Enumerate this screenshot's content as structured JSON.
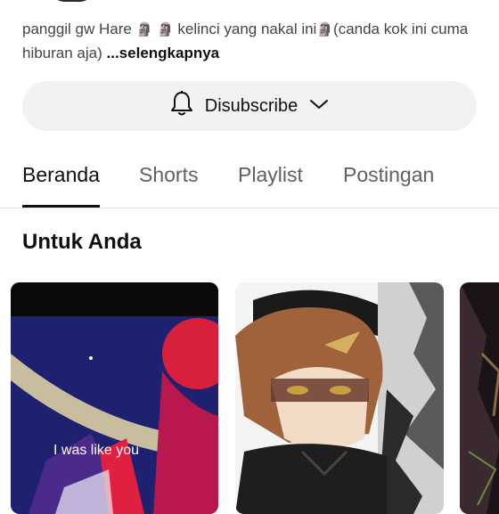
{
  "channel": {
    "description_part1": "panggil gw Hare ",
    "emoji": "🗿",
    "description_part2": " kelinci yang nakal ini",
    "description_part3": "(canda kok ini cuma hiburan aja) ",
    "more_label": "...selengkapnya"
  },
  "subscribe": {
    "label": "Disubscribe",
    "bell_icon": "bell-icon",
    "chevron_icon": "chevron-down-icon"
  },
  "tabs": [
    {
      "label": "Beranda",
      "active": true
    },
    {
      "label": "Shorts",
      "active": false
    },
    {
      "label": "Playlist",
      "active": false
    },
    {
      "label": "Postingan",
      "active": false
    }
  ],
  "section": {
    "title": "Untuk Anda"
  },
  "shorts": [
    {
      "overlay_text": "I was like you"
    },
    {
      "overlay_text": ""
    },
    {
      "overlay_text": ""
    }
  ]
}
